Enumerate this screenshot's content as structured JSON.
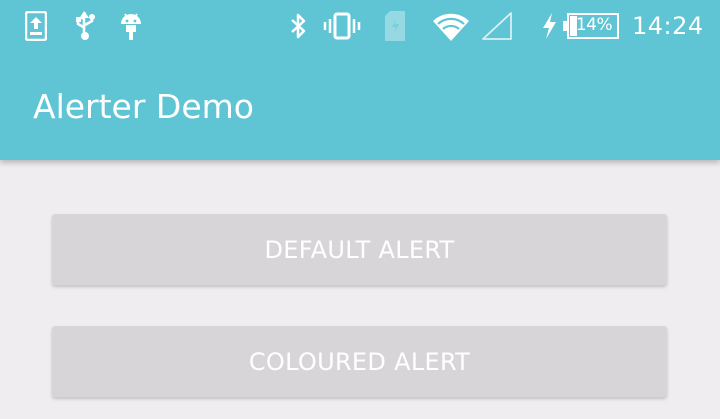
{
  "status_bar": {
    "icons": [
      "upload-icon",
      "usb-icon",
      "android-icon",
      "bluetooth-icon",
      "vibrate-icon",
      "sim-card-icon",
      "wifi-icon",
      "cell-signal-icon",
      "charging-bolt-icon",
      "battery-icon"
    ],
    "battery_percent": "14%",
    "time": "14:24"
  },
  "toolbar": {
    "title": "Alerter Demo"
  },
  "buttons": {
    "default_alert": "DEFAULT ALERT",
    "coloured_alert": "COLOURED ALERT"
  },
  "colors": {
    "app_bar": "#5fc5d4",
    "background": "#efedf0",
    "button": "#d8d5d9",
    "text_on_primary": "#ffffff"
  }
}
